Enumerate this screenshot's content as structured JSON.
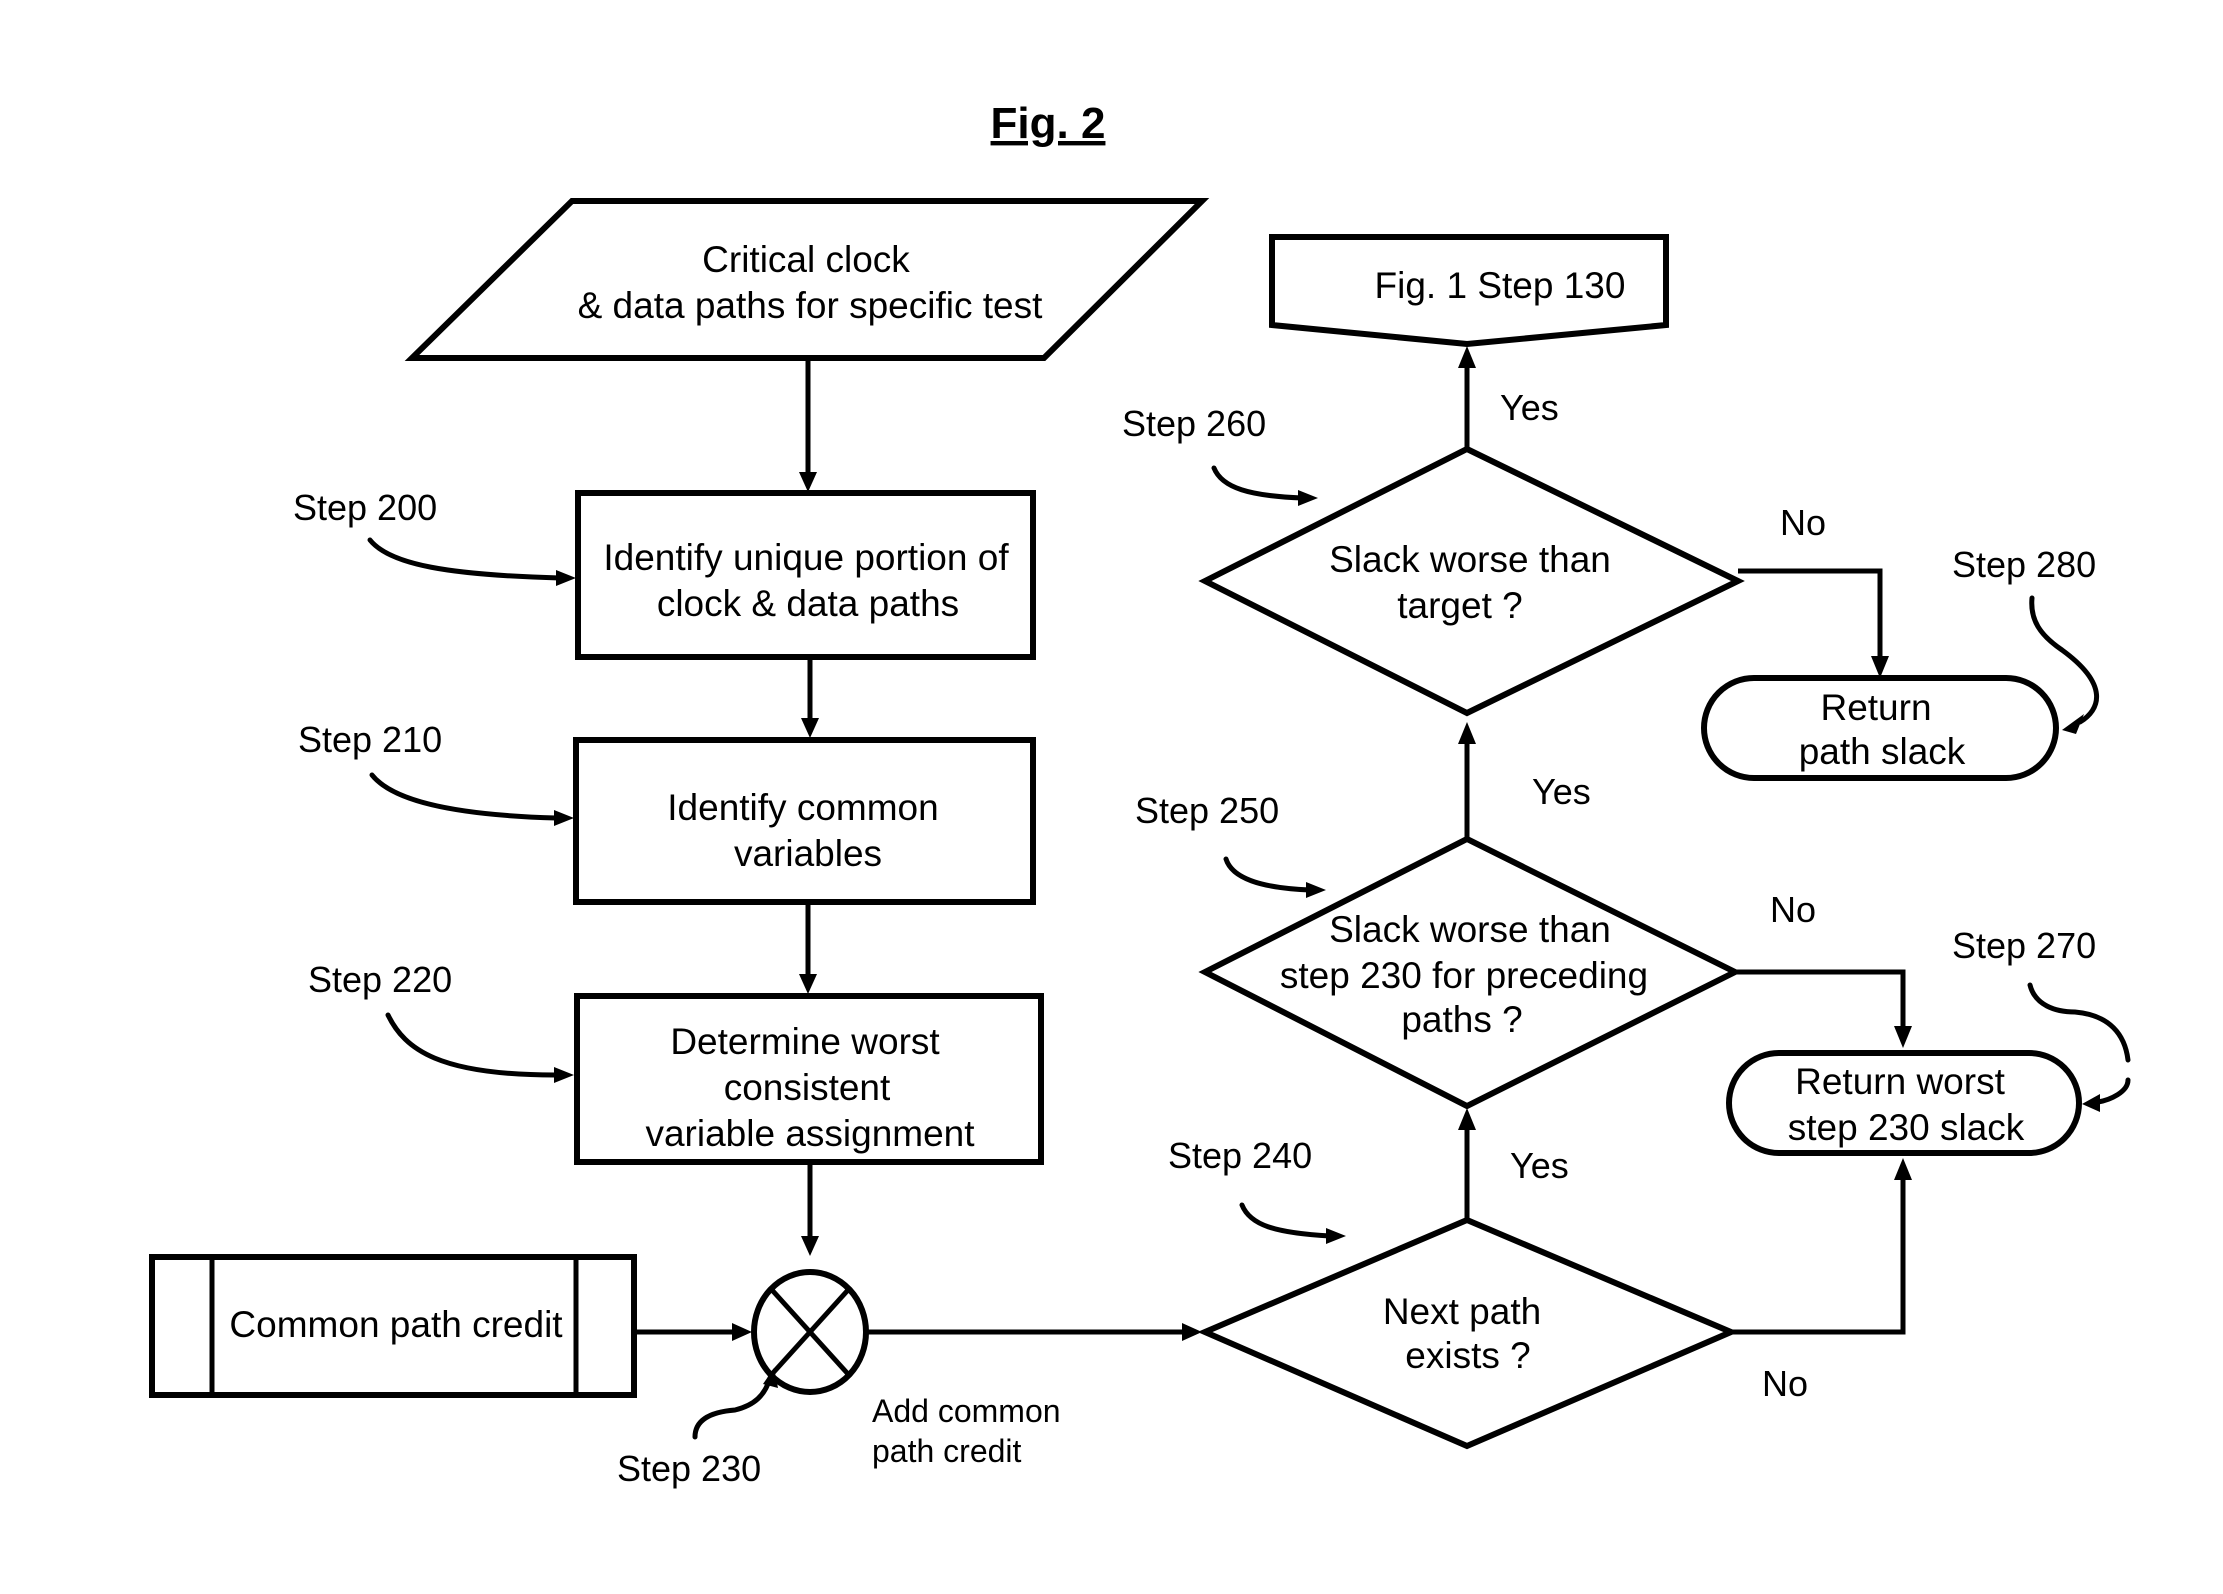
{
  "figure": {
    "title": "Fig. 2"
  },
  "nodes": {
    "input": {
      "lines": [
        "Critical clock",
        "& data paths for specific test"
      ]
    },
    "step200": {
      "label": "Step 200",
      "lines": [
        "Identify unique portion of",
        "clock & data paths"
      ]
    },
    "step210": {
      "label": "Step 210",
      "lines": [
        "Identify common",
        "variables"
      ]
    },
    "step220": {
      "label": "Step 220",
      "lines": [
        "Determine worst",
        "consistent",
        "variable assignment"
      ]
    },
    "credit": {
      "lines": [
        "Common path credit"
      ]
    },
    "step230": {
      "label": "Step 230",
      "caption_lines": [
        "Add common",
        "path credit"
      ],
      "symbol": "summing-junction"
    },
    "step240": {
      "label": "Step 240",
      "lines": [
        "Next path",
        "exists ?"
      ]
    },
    "step250": {
      "label": "Step 250",
      "lines": [
        "Slack worse than",
        "step 230 for preceding",
        "paths ?"
      ]
    },
    "step260": {
      "label": "Step 260",
      "lines": [
        "Slack worse than",
        "target ?"
      ]
    },
    "step270": {
      "label": "Step 270",
      "lines": [
        "Return worst",
        "step 230 slack"
      ]
    },
    "step280": {
      "label": "Step 280",
      "lines": [
        "Return",
        "path slack"
      ]
    },
    "offpage": {
      "lines": [
        "Fig. 1 Step 130"
      ]
    }
  },
  "edges": {
    "e240_250": "Yes",
    "e240_270": "No",
    "e250_260": "Yes",
    "e250_270": "No",
    "e260_130": "Yes",
    "e260_280": "No"
  }
}
